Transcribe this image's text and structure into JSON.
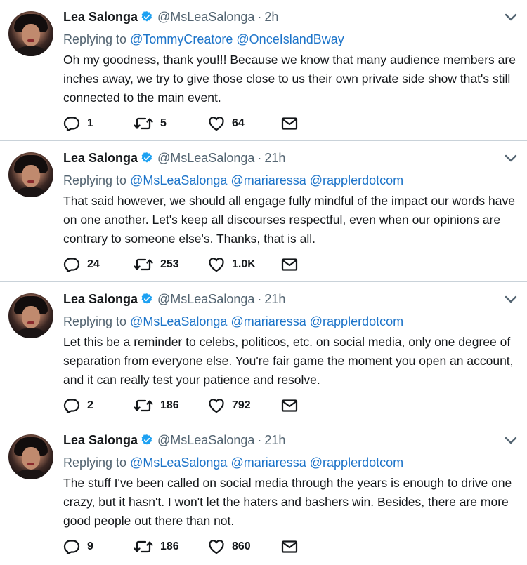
{
  "colors": {
    "link": "#1d74c9",
    "verified": "#1da1f2",
    "secondary_text": "#536471",
    "divider": "#c9d2d9"
  },
  "icons": {
    "verified": "verified-badge-icon",
    "caret": "chevron-down-icon",
    "reply": "reply-icon",
    "retweet": "retweet-icon",
    "like": "heart-icon",
    "dm": "envelope-icon"
  },
  "tweets": [
    {
      "name": "Lea Salonga",
      "handle": "@MsLeaSalonga",
      "dot": "·",
      "time": "2h",
      "replying_prefix": "Replying to",
      "mentions": [
        "@TommyCreatore",
        "@OnceIslandBway",
        ""
      ],
      "text": "Oh my goodness, thank you!!! Because we know that many audience members are inches away, we try to give those close to us their own private side show that's still connected to the main event.",
      "reply_count": "1",
      "retweet_count": "5",
      "like_count": "64"
    },
    {
      "name": "Lea Salonga",
      "handle": "@MsLeaSalonga",
      "dot": "·",
      "time": "21h",
      "replying_prefix": "Replying to",
      "mentions": [
        "@MsLeaSalonga",
        "@mariaressa",
        "@rapplerdotcom"
      ],
      "text": "That said however, we should all engage fully mindful of the impact our words have on one another. Let's keep all discourses respectful, even when our opinions are contrary to someone else's. Thanks, that is all.",
      "reply_count": "24",
      "retweet_count": "253",
      "like_count": "1.0K"
    },
    {
      "name": "Lea Salonga",
      "handle": "@MsLeaSalonga",
      "dot": "·",
      "time": "21h",
      "replying_prefix": "Replying to",
      "mentions": [
        "@MsLeaSalonga",
        "@mariaressa",
        "@rapplerdotcom"
      ],
      "text": "Let this be a reminder to celebs, politicos, etc. on social media, only one degree of separation from everyone else. You're fair game the moment you open an account, and it can really test your patience and resolve.",
      "reply_count": "2",
      "retweet_count": "186",
      "like_count": "792"
    },
    {
      "name": "Lea Salonga",
      "handle": "@MsLeaSalonga",
      "dot": "·",
      "time": "21h",
      "replying_prefix": "Replying to",
      "mentions": [
        "@MsLeaSalonga",
        "@mariaressa",
        "@rapplerdotcom"
      ],
      "text": "The stuff I've been called on social media through the years is enough to drive one crazy, but it hasn't. I won't let the haters and bashers win. Besides, there are more good people out there than not.",
      "reply_count": "9",
      "retweet_count": "186",
      "like_count": "860"
    }
  ]
}
